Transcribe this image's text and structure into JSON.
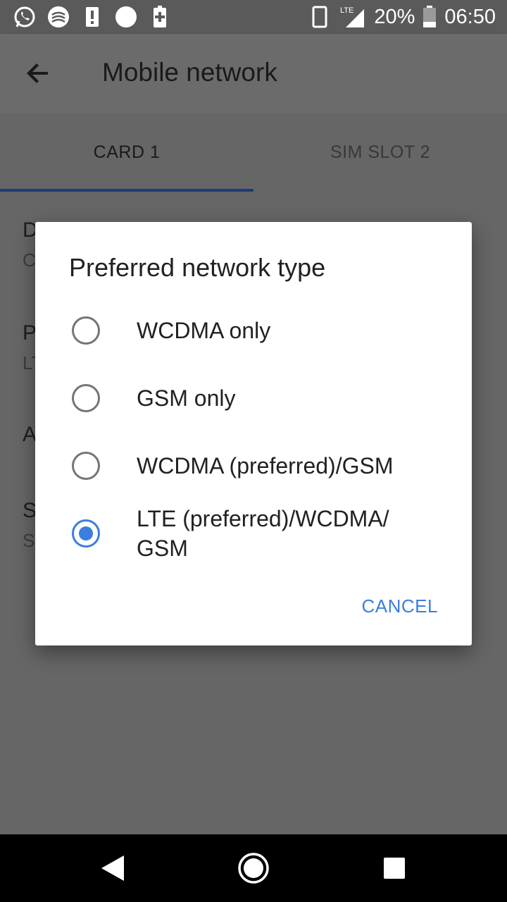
{
  "status_bar": {
    "left_icons": [
      "whatsapp-icon",
      "bank-icon",
      "alert-icon",
      "circle-icon",
      "battery-plus-icon"
    ],
    "network": "LTE",
    "battery": "20%",
    "time": "06:50"
  },
  "app_bar": {
    "title": "Mobile network"
  },
  "tabs": [
    {
      "label": "CARD 1",
      "selected": true
    },
    {
      "label": "SIM SLOT 2",
      "selected": false
    }
  ],
  "background_items": [
    {
      "title": "D",
      "subtitle": "C"
    },
    {
      "title": "P",
      "subtitle": "LT"
    },
    {
      "title": "A",
      "subtitle": ""
    },
    {
      "title": "S",
      "subtitle": "S"
    }
  ],
  "dialog": {
    "title": "Preferred network type",
    "options": [
      {
        "label": "WCDMA only",
        "checked": false
      },
      {
        "label": "GSM only",
        "checked": false
      },
      {
        "label": "WCDMA (preferred)/GSM",
        "checked": false
      },
      {
        "label": "LTE (preferred)/WCDMA/ GSM",
        "checked": true
      }
    ],
    "cancel_label": "CANCEL"
  },
  "nav_bar": {
    "buttons": [
      "back-icon",
      "home-icon",
      "recents-icon"
    ]
  },
  "colors": {
    "accent": "#3b7ee0",
    "scrim": "#666666",
    "tab_indicator": "#203a78"
  }
}
